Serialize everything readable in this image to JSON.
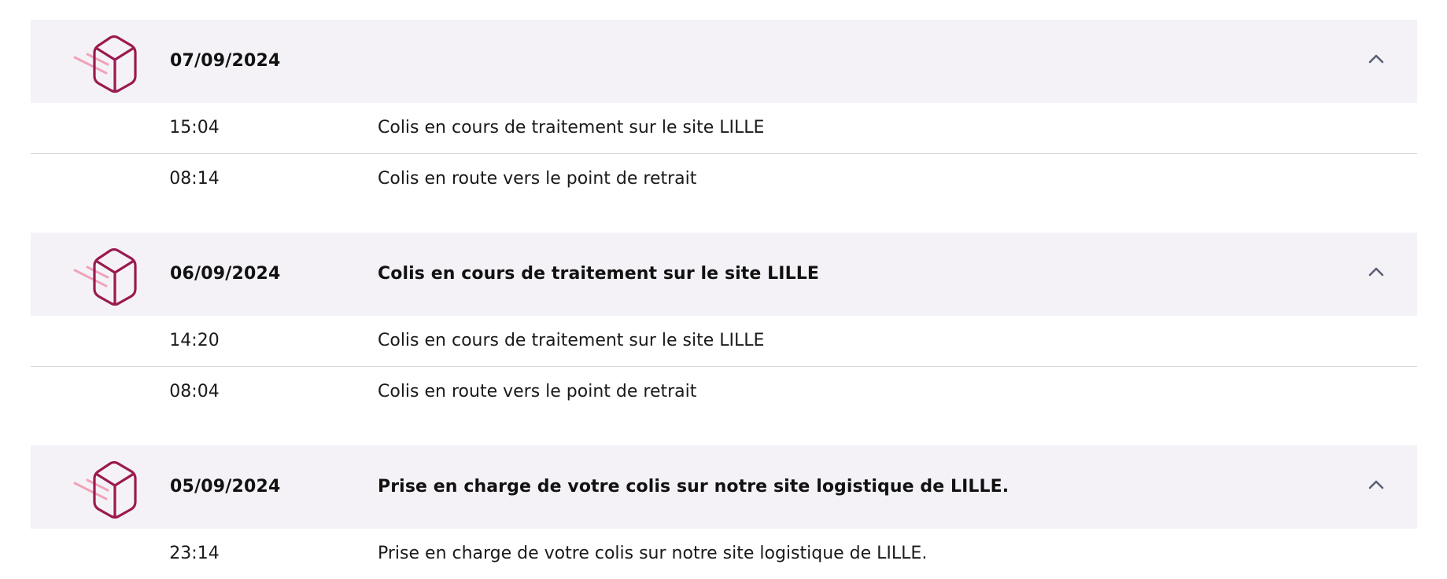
{
  "colors": {
    "header_bg": "#f4f2f7",
    "icon_box": "#9b1a4f",
    "icon_lines": "#f0a3b9",
    "chevron": "#5a5f73",
    "divider": "#d9d9d9"
  },
  "groups": [
    {
      "date": "07/09/2024",
      "summary": "",
      "icon": "parcel-icon",
      "toggle_icon": "chevron-up-icon",
      "events": [
        {
          "time": "15:04",
          "text": "Colis en cours de traitement sur le site LILLE"
        },
        {
          "time": "08:14",
          "text": "Colis en route vers le point de retrait"
        }
      ]
    },
    {
      "date": "06/09/2024",
      "summary": "Colis en cours de traitement sur le site LILLE",
      "icon": "parcel-icon",
      "toggle_icon": "chevron-up-icon",
      "events": [
        {
          "time": "14:20",
          "text": "Colis en cours de traitement sur le site LILLE"
        },
        {
          "time": "08:04",
          "text": "Colis en route vers le point de retrait"
        }
      ]
    },
    {
      "date": "05/09/2024",
      "summary": "Prise en charge de votre colis sur notre site logistique de LILLE.",
      "icon": "parcel-icon",
      "toggle_icon": "chevron-up-icon",
      "events": [
        {
          "time": "23:14",
          "text": "Prise en charge de votre colis sur notre site logistique de LILLE."
        }
      ]
    }
  ]
}
